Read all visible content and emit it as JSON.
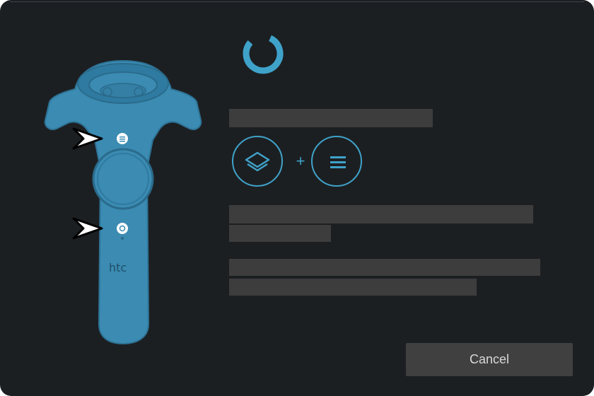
{
  "dialog": {
    "cancel_label": "Cancel"
  },
  "controller": {
    "brand": "htc",
    "menu_button_icon": "menu-button-icon",
    "system_button_icon": "system-button-icon"
  },
  "combo": {
    "first_icon": "layers-icon",
    "separator": "+",
    "second_icon": "hamburger-menu-icon"
  },
  "colors": {
    "accent": "#3fa2c9",
    "controller_body": "#3b8bb2",
    "background": "#1c1f22",
    "redaction": "#3d3d3d",
    "button": "#404040"
  }
}
